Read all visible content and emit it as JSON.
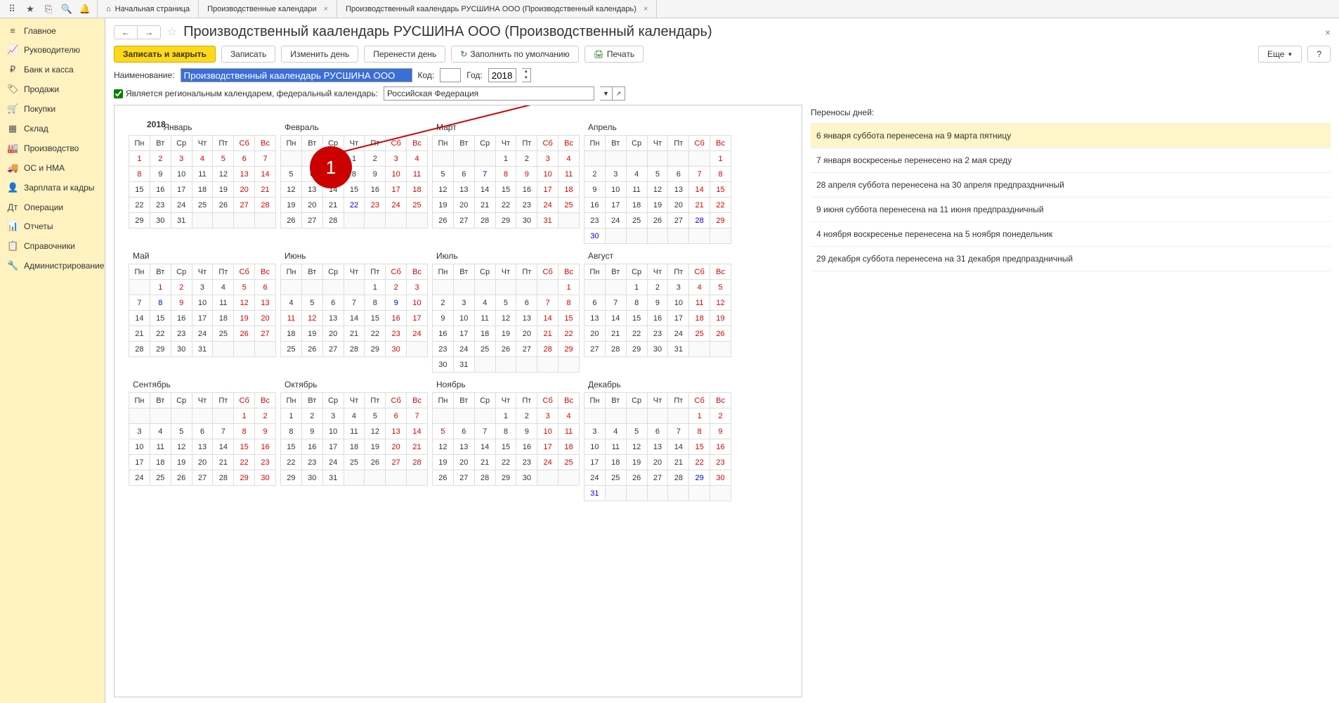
{
  "top_icons": [
    "⠿",
    "★",
    "⎘",
    "🔍",
    "🔔"
  ],
  "tabs": {
    "home": "Начальная страница",
    "t1": "Производственные календари",
    "t2": "Производственный каалендарь РУСШИНА ООО (Производственный календарь)"
  },
  "sidebar": [
    {
      "icon": "≡",
      "label": "Главное"
    },
    {
      "icon": "📈",
      "label": "Руководителю"
    },
    {
      "icon": "₽",
      "label": "Банк и касса"
    },
    {
      "icon": "🏷",
      "label": "Продажи"
    },
    {
      "icon": "🛒",
      "label": "Покупки"
    },
    {
      "icon": "▦",
      "label": "Склад"
    },
    {
      "icon": "🏭",
      "label": "Производство"
    },
    {
      "icon": "🚚",
      "label": "ОС и НМА"
    },
    {
      "icon": "👤",
      "label": "Зарплата и кадры"
    },
    {
      "icon": "Дт",
      "label": "Операции"
    },
    {
      "icon": "📊",
      "label": "Отчеты"
    },
    {
      "icon": "📋",
      "label": "Справочники"
    },
    {
      "icon": "🔧",
      "label": "Администрирование"
    }
  ],
  "page": {
    "title": "Производственный каалендарь РУСШИНА ООО (Производственный календарь)",
    "btn_save_close": "Записать и закрыть",
    "btn_save": "Записать",
    "btn_change_day": "Изменить день",
    "btn_move_day": "Перенести день",
    "btn_fill_default": "Заполнить по умолчанию",
    "btn_print": "Печать",
    "btn_more": "Еще",
    "label_name": "Наименование:",
    "value_name": "Производственный каалендарь РУСШИНА ООО",
    "label_code": "Код:",
    "label_year": "Год:",
    "value_year": "2018",
    "regional_label": "Является региональным календарем, федеральный календарь:",
    "regional_value": "Российская Федерация"
  },
  "transfers": {
    "title": "Переносы дней:",
    "items": [
      "6 января суббота перенесена на 9 марта пятницу",
      "7 января воскресенье перенесено на 2 мая среду",
      "28 апреля суббота перенесена на 30 апреля предпраздничный",
      "9 июня суббота перенесена на 11 июня предпраздничный",
      "4 ноября воскресенье перенесена на 5 ноября понедельник",
      "29 декабря суббота перенесена на 31 декабря предпраздничный"
    ]
  },
  "annotation": "1",
  "calendar": {
    "year": "2018",
    "weekdays": [
      "Пн",
      "Вт",
      "Ср",
      "Чт",
      "Пт",
      "Сб",
      "Вс"
    ],
    "months": [
      {
        "name": "Январь",
        "offset": 0,
        "days": 31,
        "holidays": [
          1,
          2,
          3,
          4,
          5,
          6,
          7,
          8,
          13,
          14,
          20,
          21,
          27,
          28
        ],
        "pre": [],
        "shifted": []
      },
      {
        "name": "Февраль",
        "offset": 3,
        "days": 28,
        "holidays": [
          3,
          4,
          10,
          11,
          17,
          18,
          23,
          24,
          25
        ],
        "pre": [
          22
        ],
        "shifted": []
      },
      {
        "name": "Март",
        "offset": 3,
        "days": 31,
        "holidays": [
          3,
          4,
          8,
          9,
          10,
          11,
          17,
          18,
          24,
          25,
          31
        ],
        "pre": [
          7
        ],
        "shifted": []
      },
      {
        "name": "Апрель",
        "offset": 6,
        "days": 30,
        "holidays": [
          1,
          7,
          8,
          14,
          15,
          21,
          22,
          29
        ],
        "pre": [
          28,
          30
        ],
        "shifted": []
      },
      {
        "name": "Май",
        "offset": 1,
        "days": 31,
        "holidays": [
          1,
          2,
          5,
          6,
          9,
          12,
          13,
          19,
          20,
          26,
          27
        ],
        "pre": [
          8
        ],
        "shifted": []
      },
      {
        "name": "Июнь",
        "offset": 4,
        "days": 30,
        "holidays": [
          2,
          3,
          10,
          11,
          12,
          16,
          17,
          23,
          24,
          30
        ],
        "pre": [
          9
        ],
        "shifted": []
      },
      {
        "name": "Июль",
        "offset": 6,
        "days": 31,
        "holidays": [
          1,
          7,
          8,
          14,
          15,
          21,
          22,
          28,
          29
        ],
        "pre": [],
        "shifted": []
      },
      {
        "name": "Август",
        "offset": 2,
        "days": 31,
        "holidays": [
          4,
          5,
          11,
          12,
          18,
          19,
          25,
          26
        ],
        "pre": [],
        "shifted": []
      },
      {
        "name": "Сентябрь",
        "offset": 5,
        "days": 30,
        "holidays": [
          1,
          2,
          8,
          9,
          15,
          16,
          22,
          23,
          29,
          30
        ],
        "pre": [],
        "shifted": []
      },
      {
        "name": "Октябрь",
        "offset": 0,
        "days": 31,
        "holidays": [
          6,
          7,
          13,
          14,
          20,
          21,
          27,
          28
        ],
        "pre": [],
        "shifted": []
      },
      {
        "name": "Ноябрь",
        "offset": 3,
        "days": 30,
        "holidays": [
          3,
          4,
          5,
          10,
          11,
          17,
          18,
          24,
          25
        ],
        "pre": [],
        "shifted": []
      },
      {
        "name": "Декабрь",
        "offset": 5,
        "days": 31,
        "holidays": [
          1,
          2,
          8,
          9,
          15,
          16,
          22,
          23,
          30
        ],
        "pre": [
          29,
          31
        ],
        "shifted": []
      }
    ]
  }
}
